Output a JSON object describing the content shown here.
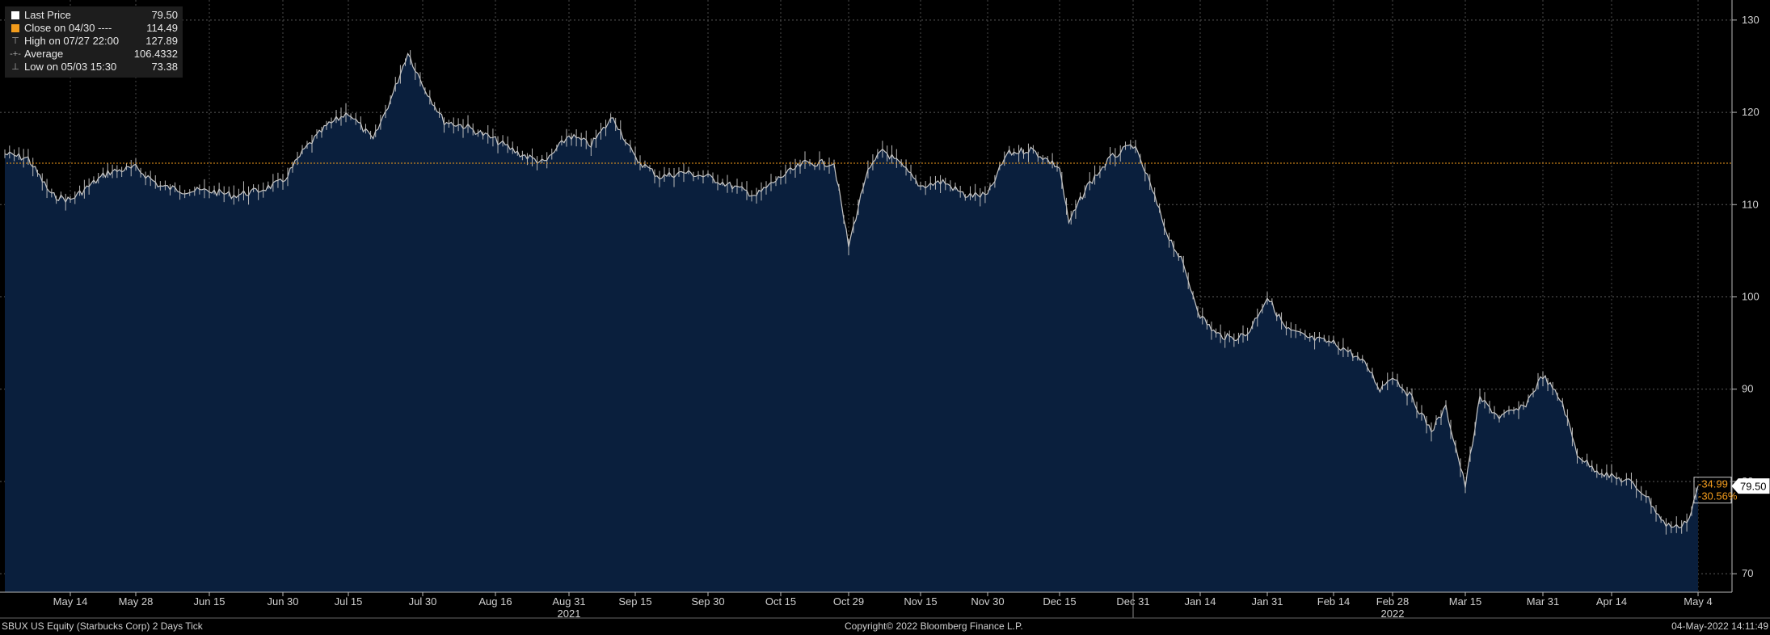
{
  "legend": {
    "last_price": {
      "label": "Last Price",
      "value": "79.50",
      "color": "#ffffff"
    },
    "close": {
      "label": "Close on 04/30 ----",
      "value": "114.49",
      "color": "#f39c1c"
    },
    "high": {
      "label": "High on 07/27 22:00",
      "value": "127.89"
    },
    "average": {
      "label": "Average",
      "value": "106.4332"
    },
    "low": {
      "label": "Low on 05/03 15:30",
      "value": "73.38"
    }
  },
  "footer": {
    "left": "SBUX US Equity (Starbucks Corp) 2 Days  Tick",
    "center": "Copyright© 2022 Bloomberg Finance L.P.",
    "right": "04-May-2022 14:11:49"
  },
  "chart_data": {
    "type": "area",
    "ylim": [
      68,
      132
    ],
    "y_ticks": [
      70,
      80,
      90,
      100,
      110,
      120,
      130
    ],
    "x_ticks": [
      "May 14",
      "May 28",
      "Jun 15",
      "Jun 30",
      "Jul 15",
      "Jul 30",
      "Aug 16",
      "Aug 31",
      "Sep 15",
      "Sep 30",
      "Oct 15",
      "Oct 29",
      "Nov 15",
      "Nov 30",
      "Dec 15",
      "Dec 31",
      "Jan 14",
      "Jan 31",
      "Feb 14",
      "Feb 28",
      "Mar 15",
      "Mar 31",
      "Apr 14",
      "May 4"
    ],
    "year_labels": [
      {
        "label": "2021",
        "at": "Aug 31"
      },
      {
        "label": "2022",
        "at": "Feb 28"
      }
    ],
    "reference_line": {
      "value": 114.49,
      "color": "#f39c1c"
    },
    "last_price_label": "79.50",
    "change_labels": [
      "-34.99",
      "-30.56%"
    ],
    "series": [
      {
        "x": [
          "Apr 30",
          "May 5",
          "May 10",
          "May 14",
          "May 18",
          "May 22",
          "May 28",
          "Jun 3",
          "Jun 9",
          "Jun 15",
          "Jun 20",
          "Jun 25",
          "Jun 30",
          "Jul 5",
          "Jul 10",
          "Jul 15",
          "Jul 20",
          "Jul 24",
          "Jul 27",
          "Jul 30",
          "Aug 4",
          "Aug 9",
          "Aug 16",
          "Aug 21",
          "Aug 26",
          "Aug 31",
          "Sep 5",
          "Sep 10",
          "Sep 15",
          "Sep 20",
          "Sep 25",
          "Sep 30",
          "Oct 5",
          "Oct 10",
          "Oct 15",
          "Oct 20",
          "Oct 26",
          "Oct 29",
          "Nov 2",
          "Nov 6",
          "Nov 11",
          "Nov 15",
          "Nov 20",
          "Nov 25",
          "Nov 30",
          "Dec 4",
          "Dec 9",
          "Dec 15",
          "Dec 17",
          "Dec 21",
          "Dec 26",
          "Dec 31",
          "Jan 3",
          "Jan 7",
          "Jan 10",
          "Jan 14",
          "Jan 18",
          "Jan 22",
          "Jan 26",
          "Jan 31",
          "Feb 4",
          "Feb 9",
          "Feb 14",
          "Feb 18",
          "Feb 22",
          "Feb 25",
          "Feb 28",
          "Mar 4",
          "Mar 8",
          "Mar 11",
          "Mar 15",
          "Mar 18",
          "Mar 22",
          "Mar 27",
          "Mar 31",
          "Apr 4",
          "Apr 7",
          "Apr 10",
          "Apr 14",
          "Apr 18",
          "Apr 22",
          "Apr 26",
          "Apr 29",
          "May 2",
          "May 4"
        ],
        "values": [
          115.5,
          115,
          111,
          110.5,
          112,
          113.5,
          114,
          112,
          111.5,
          111.5,
          111,
          111.5,
          112.5,
          116,
          118.5,
          120,
          117,
          122,
          126.5,
          123,
          119,
          118.5,
          117,
          115.5,
          114.5,
          117.5,
          116.5,
          119.5,
          115,
          113,
          113.5,
          113,
          112,
          111,
          113,
          114.5,
          114.5,
          105.5,
          113,
          116,
          114,
          112,
          112.5,
          111,
          111,
          115.5,
          116,
          114,
          108,
          112,
          115,
          116.5,
          113,
          107,
          104,
          98,
          96,
          95.5,
          96,
          100,
          96.5,
          95.5,
          95,
          94,
          92.5,
          90,
          91.5,
          89,
          85.5,
          88,
          79.5,
          89,
          87,
          88,
          91.5,
          88.5,
          83,
          81.5,
          80.5,
          80,
          78.5,
          75.5,
          75,
          76,
          79.5
        ]
      }
    ]
  }
}
